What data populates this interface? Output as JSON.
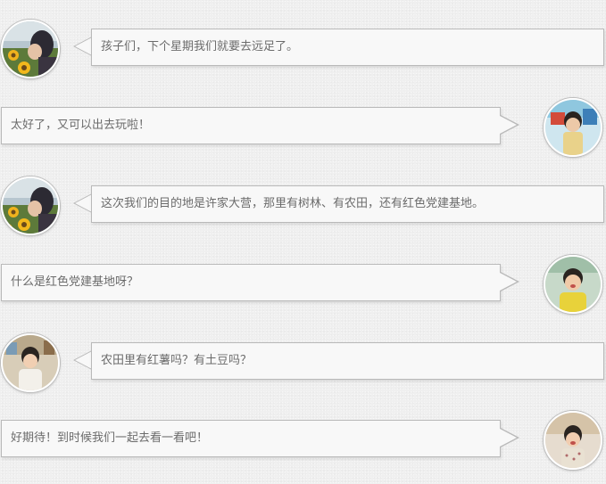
{
  "messages": [
    {
      "side": "left",
      "avatar": "teacher-avatar",
      "text": "孩子们，下个星期我们就要去远足了。"
    },
    {
      "side": "right",
      "avatar": "child-avatar-1",
      "text": "太好了，又可以出去玩啦！"
    },
    {
      "side": "left",
      "avatar": "teacher-avatar",
      "text": "这次我们的目的地是许家大营，那里有树林、有农田，还有红色党建基地。"
    },
    {
      "side": "right",
      "avatar": "child-avatar-2",
      "text": "什么是红色党建基地呀？"
    },
    {
      "side": "left",
      "avatar": "child-avatar-3",
      "text": "农田里有红薯吗？有土豆吗？"
    },
    {
      "side": "right",
      "avatar": "child-avatar-4",
      "text": "好期待！到时候我们一起去看一看吧！"
    }
  ],
  "colors": {
    "background": "#efefef",
    "bubble": "#f8f8f8",
    "bubble_border": "#b9b9b9",
    "text": "#6b6b6b"
  }
}
